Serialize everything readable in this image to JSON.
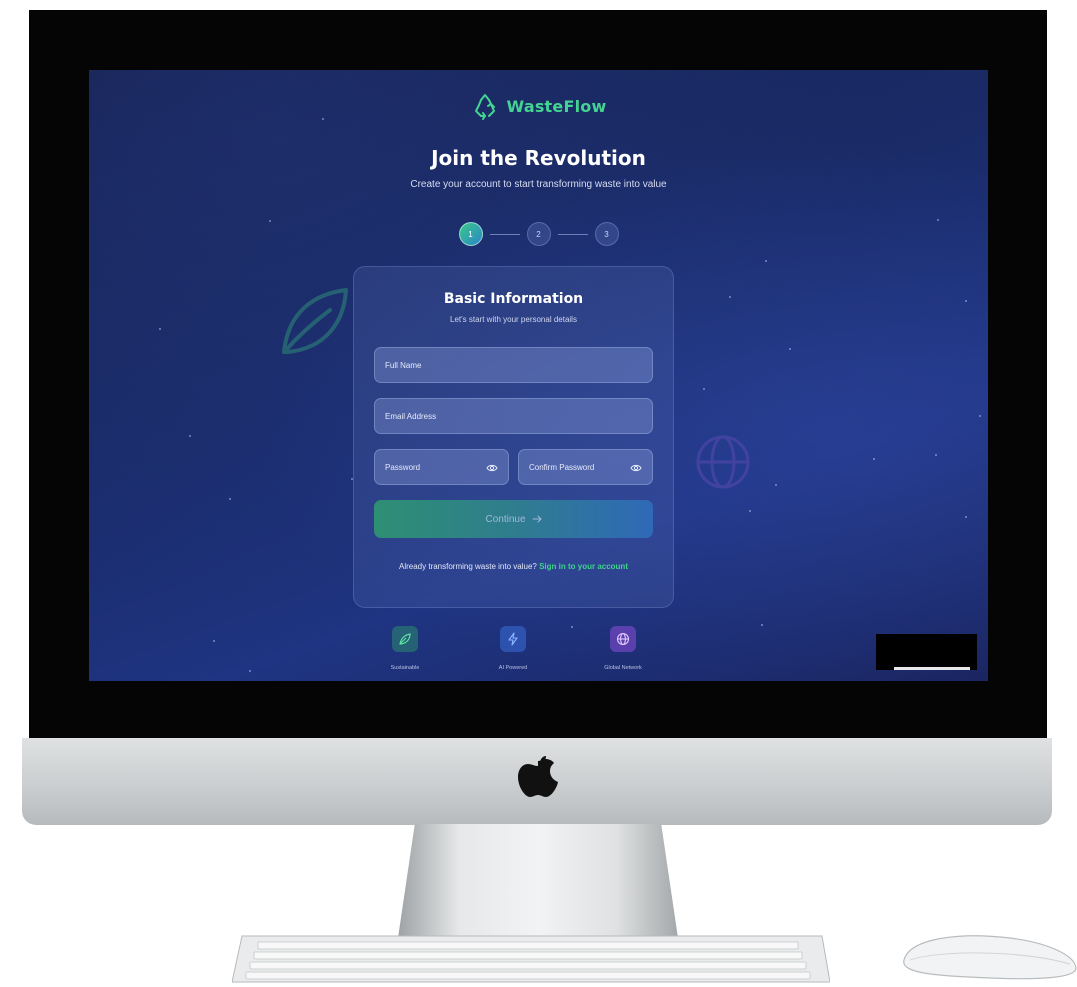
{
  "app": {
    "brand_name": "WasteFlow",
    "title": "Join the Revolution",
    "subtitle": "Create your account to start transforming waste into value"
  },
  "stepper": {
    "steps": [
      "1",
      "2",
      "3"
    ],
    "active_step": 1
  },
  "card": {
    "title": "Basic Information",
    "subtitle": "Let's start with your personal details",
    "full_name": {
      "placeholder": "Full Name",
      "value": ""
    },
    "email": {
      "placeholder": "Email Address",
      "value": ""
    },
    "password": {
      "placeholder": "Password",
      "value": ""
    },
    "confirm_password": {
      "placeholder": "Confirm Password",
      "value": ""
    },
    "continue_label": "Continue",
    "signin_prompt": "Already transforming waste into value?",
    "signin_link": "Sign in to your account"
  },
  "features": [
    {
      "label": "Sustainable",
      "icon": "leaf-icon",
      "color": "#2f9e6a"
    },
    {
      "label": "AI Powered",
      "icon": "lightning-icon",
      "color": "#3a6fd8"
    },
    {
      "label": "Global Network",
      "icon": "globe-icon",
      "color": "#8a4fd8"
    }
  ],
  "colors": {
    "brand_green": "#43d492",
    "link_green": "#3ed38b",
    "background_navy": "#1a2c6b"
  }
}
